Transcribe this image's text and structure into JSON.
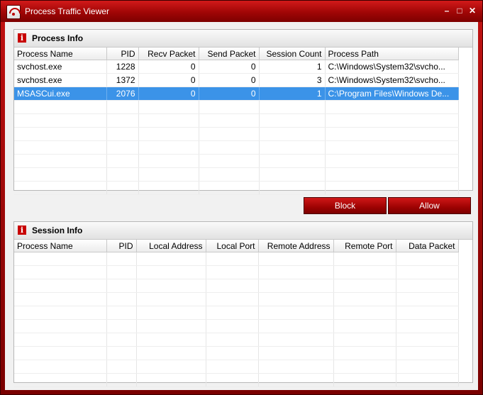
{
  "window": {
    "title": "Process Traffic Viewer"
  },
  "titlebar_buttons": {
    "minimize": "–",
    "maximize": "□",
    "close": "✕"
  },
  "process_info": {
    "title": "Process Info",
    "columns": [
      "Process Name",
      "PID",
      "Recv Packet",
      "Send Packet",
      "Session Count",
      "Process Path"
    ],
    "rows": [
      {
        "name": "svchost.exe",
        "pid": "1228",
        "recv": "0",
        "send": "0",
        "sessions": "1",
        "path": "C:\\Windows\\System32\\svcho..."
      },
      {
        "name": "svchost.exe",
        "pid": "1372",
        "recv": "0",
        "send": "0",
        "sessions": "3",
        "path": "C:\\Windows\\System32\\svcho..."
      },
      {
        "name": "MSASCui.exe",
        "pid": "2076",
        "recv": "0",
        "send": "0",
        "sessions": "1",
        "path": "C:\\Program Files\\Windows De..."
      }
    ]
  },
  "actions": {
    "block": "Block",
    "allow": "Allow"
  },
  "session_info": {
    "title": "Session Info",
    "columns": [
      "Process Name",
      "PID",
      "Local Address",
      "Local Port",
      "Remote Address",
      "Remote Port",
      "Data Packet"
    ]
  },
  "colors": {
    "accent": "#c31212",
    "selection": "#3b93e8"
  }
}
